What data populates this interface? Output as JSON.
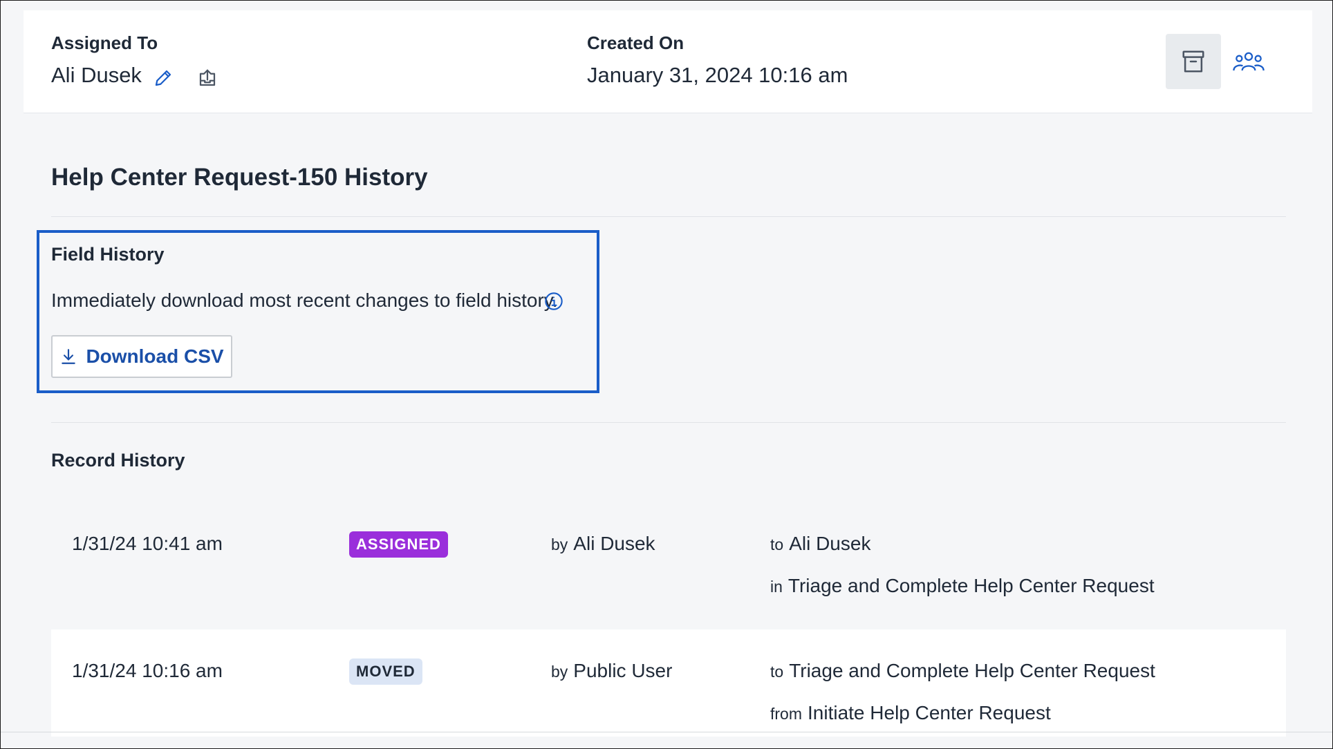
{
  "header": {
    "assigned_label": "Assigned To",
    "assigned_value": "Ali Dusek",
    "created_label": "Created On",
    "created_value": "January 31, 2024 10:16 am"
  },
  "icons": {
    "edit": "pencil-icon",
    "reassign": "share-upload-icon",
    "archive": "archive-icon",
    "team": "team-icon",
    "info": "info-icon",
    "download": "download-icon"
  },
  "history": {
    "title": "Help Center Request-150 History",
    "field_history": {
      "title": "Field History",
      "description": "Immediately download most recent changes to field history.",
      "button_label": "Download CSV"
    },
    "record_history": {
      "title": "Record History",
      "rows": [
        {
          "timestamp": "1/31/24 10:41 am",
          "badge": "ASSIGNED",
          "by_prefix": "by",
          "by": "Ali Dusek",
          "line1_prefix": "to",
          "line1": "Ali Dusek",
          "line2_prefix": "in",
          "line2": "Triage and Complete Help Center Request"
        },
        {
          "timestamp": "1/31/24 10:16 am",
          "badge": "MOVED",
          "by_prefix": "by",
          "by": "Public User",
          "line1_prefix": "to",
          "line1": "Triage and Complete Help Center Request",
          "line2_prefix": "from",
          "line2": "Initiate Help Center Request"
        }
      ]
    }
  },
  "colors": {
    "accent": "#1a5dc8",
    "assigned_badge": "#9a2fdb",
    "moved_badge": "#dbe5f5",
    "link": "#1a4fa8"
  }
}
